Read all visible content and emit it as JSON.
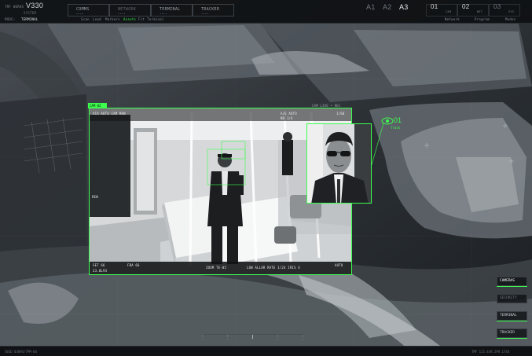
{
  "topbar": {
    "brand_label": "TMF WORKS",
    "version": "V330",
    "brand_sub": "SYSTEM",
    "mode_label": "MODE:",
    "mode_value": "TERMINAL",
    "nav": [
      {
        "label": "COMMS",
        "sub": "••••"
      },
      {
        "label": "NETWORK",
        "sub": "••••"
      },
      {
        "label": "TERMINAL",
        "sub": "••••"
      },
      {
        "label": "TRACKER",
        "sub": "••••"
      }
    ],
    "areas": [
      {
        "label": "A1",
        "active": false
      },
      {
        "label": "A2",
        "active": false
      },
      {
        "label": "A3",
        "active": true
      }
    ],
    "cams": [
      {
        "num": "01",
        "tag": "CAM",
        "dim": false
      },
      {
        "num": "02",
        "tag": "NET",
        "dim": false
      },
      {
        "num": "03",
        "tag": "SYS",
        "dim": true
      }
    ],
    "subnav": [
      {
        "label": "Scan",
        "active": false
      },
      {
        "label": "Load",
        "active": false
      },
      {
        "label": "Markers",
        "active": false
      },
      {
        "label": "Assets",
        "active": true
      },
      {
        "label": "Fit",
        "active": false
      },
      {
        "label": "Terminal",
        "active": false
      }
    ],
    "right_links": [
      "Network",
      "Program",
      "Modes"
    ]
  },
  "feed": {
    "tag": "CAM 02",
    "top_left": "VCA AUTO   CAM MAN",
    "top_mid": "A/E AUTO",
    "top_mid2": "ND 1/4",
    "top_right": "1/60",
    "header_right": "CAM LIVE • REC",
    "side_left": "REW",
    "bottom_left_1": "SET 66",
    "bottom_left_2": "23.0L93",
    "bottom_left_3": "FBA 66",
    "bottom_mid": "ZOOM TE-05",
    "bottom_mid2": "LOW  ALLAR  RATE 1/24  IRIS 4",
    "bottom_right": "AUTO"
  },
  "tracker": {
    "number": "01",
    "label": "Track"
  },
  "side_panel": [
    {
      "label": "CAMERAS",
      "style": "active"
    },
    {
      "label": "SECURITY",
      "style": "dim"
    },
    {
      "label": "TERMINAL",
      "style": "normal"
    },
    {
      "label": "TRACKER",
      "style": "normal"
    }
  ],
  "bottombar": {
    "left": "SEED 03094/7PM-04",
    "right": "TMF 115.449.299.1744"
  },
  "timeline_ticks": [
    "-2",
    "-1",
    "0",
    "+1",
    "+2"
  ],
  "colors": {
    "accent": "#3cff4e",
    "bar_bg": "#0e1012"
  }
}
